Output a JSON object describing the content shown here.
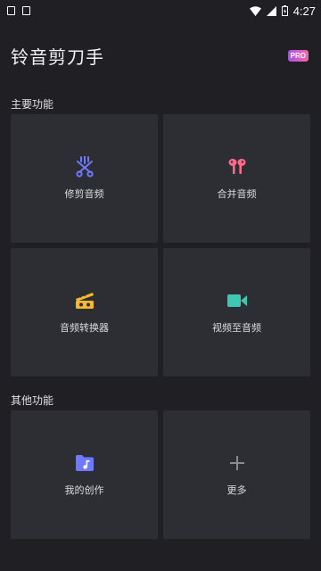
{
  "status_bar": {
    "time": "4:27"
  },
  "header": {
    "title": "铃音剪刀手",
    "pro_badge": "PRO"
  },
  "sections": {
    "main": {
      "title": "主要功能",
      "cards": [
        {
          "label": "修剪音频",
          "icon": "scissors-icon",
          "color": "#6e79ff"
        },
        {
          "label": "合并音频",
          "icon": "earbuds-icon",
          "color": "#ff6b86"
        },
        {
          "label": "音频转换器",
          "icon": "clapper-icon",
          "color": "#f5b82e"
        },
        {
          "label": "视频至音频",
          "icon": "video-camera-icon",
          "color": "#3ec8b4"
        }
      ]
    },
    "other": {
      "title": "其他功能",
      "cards": [
        {
          "label": "我的创作",
          "icon": "music-folder-icon",
          "color": "#6e79ff"
        },
        {
          "label": "更多",
          "icon": "plus-icon",
          "color": "#8a8a90"
        }
      ]
    }
  },
  "colors": {
    "background": "#1f1f24",
    "card": "#2d2e33"
  }
}
